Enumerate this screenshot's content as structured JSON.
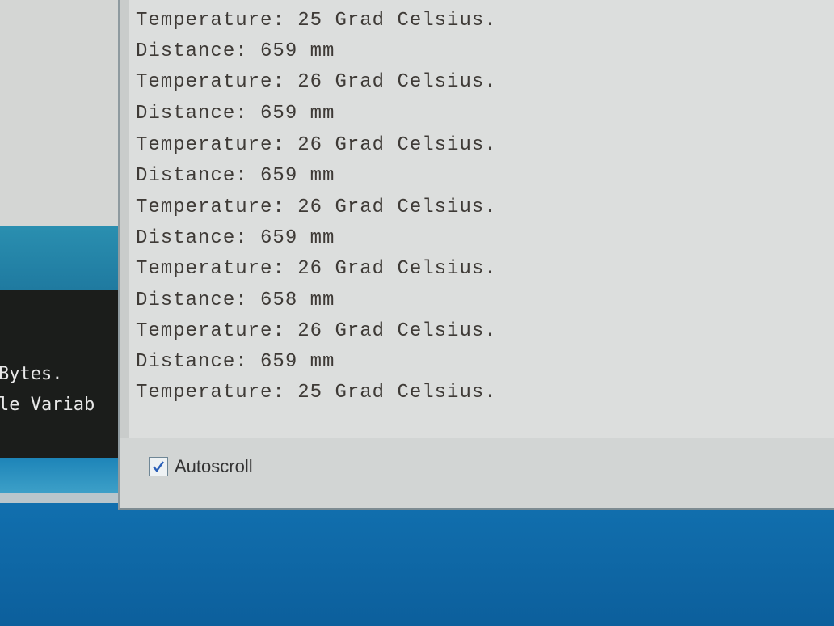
{
  "background_console": {
    "lines": [
      "Bytes.",
      "le Variab"
    ]
  },
  "serial_monitor": {
    "log_lines": [
      "Temperature: 25 Grad Celsius.",
      "Distance: 659 mm",
      "Temperature: 26 Grad Celsius.",
      "Distance: 659 mm",
      "Temperature: 26 Grad Celsius.",
      "Distance: 659 mm",
      "Temperature: 26 Grad Celsius.",
      "Distance: 659 mm",
      "Temperature: 26 Grad Celsius.",
      "Distance: 658 mm",
      "Temperature: 26 Grad Celsius.",
      "Distance: 659 mm",
      "Temperature: 25 Grad Celsius."
    ],
    "autoscroll": {
      "label": "Autoscroll",
      "checked": true
    }
  },
  "colors": {
    "desktop_blue": "#1c86c8",
    "text": "#3e3a36",
    "checkbox_check": "#2a5fb8"
  }
}
